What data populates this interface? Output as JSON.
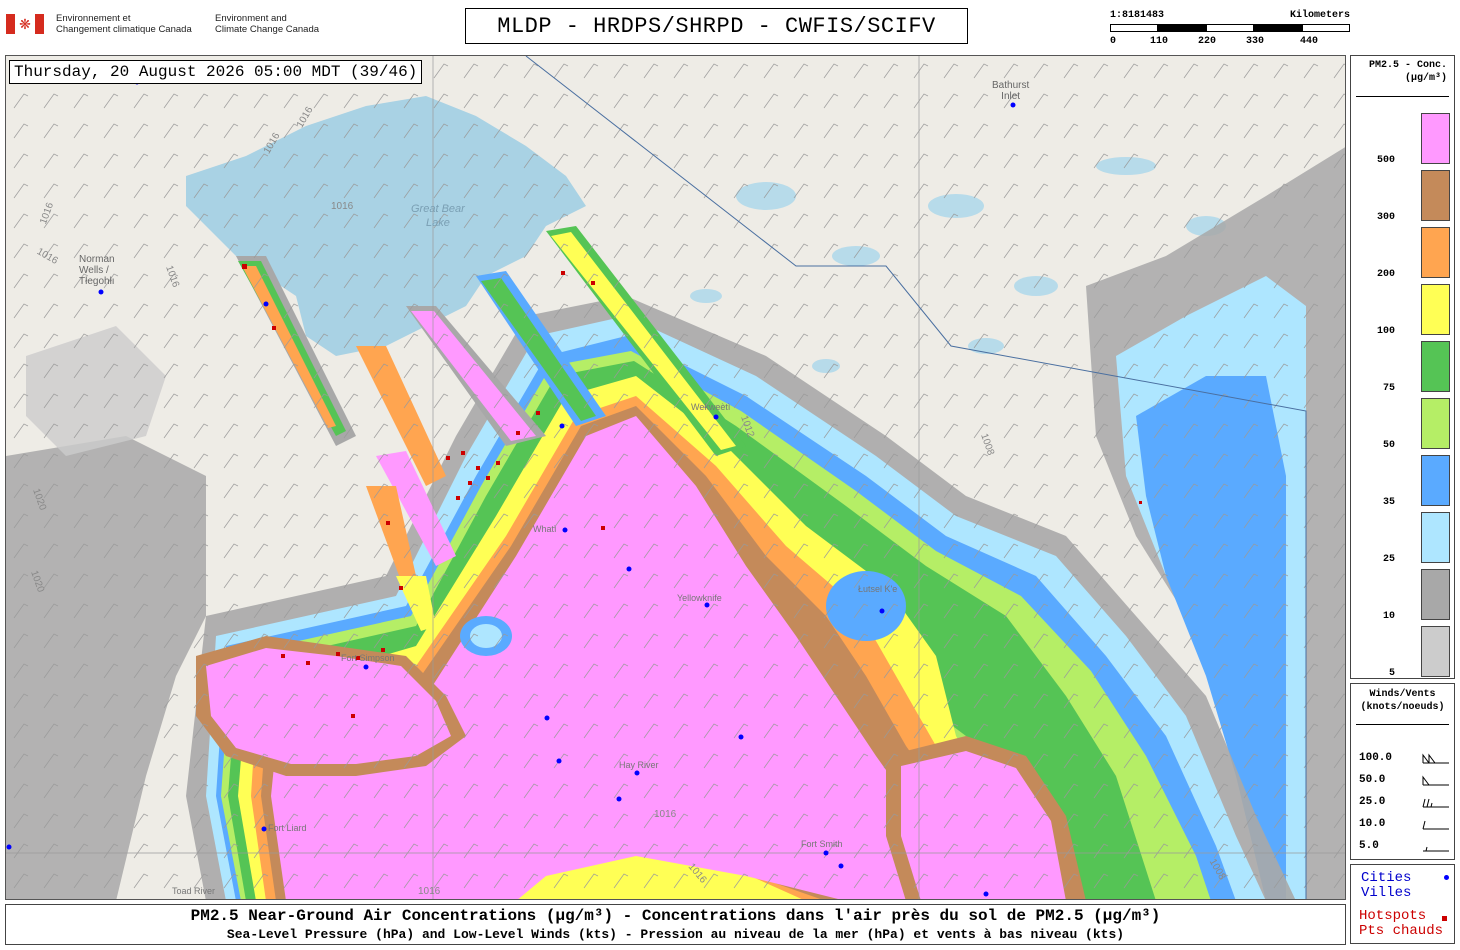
{
  "header": {
    "gov_fr": "Environnement et\nChangement climatique Canada",
    "gov_en": "Environment and\nClimate Change Canada",
    "title": "MLDP - HRDPS/SHRPD - CWFIS/SCIFV"
  },
  "scalebar": {
    "ratio": "1:8181483",
    "unit": "Kilometers",
    "ticks": [
      "0",
      "110",
      "220",
      "330",
      "440"
    ]
  },
  "map": {
    "timestamp": "Thursday, 20 August 2026 05:00 MDT (39/46)",
    "places": [
      {
        "name": "Bathurst\nInlet"
      },
      {
        "name": "Great Bear\nLake"
      },
      {
        "name": "Norman\nWells /\nTłegohłı"
      },
      {
        "name": "Wekweètì"
      },
      {
        "name": "Whatì"
      },
      {
        "name": "Yellowknife"
      },
      {
        "name": "Łutsel K'e"
      },
      {
        "name": "Fort Simpson"
      },
      {
        "name": "Hay River"
      },
      {
        "name": "Fort Smith"
      },
      {
        "name": "Fort Liard"
      },
      {
        "name": "Toad River"
      }
    ],
    "isobars": [
      "1016",
      "1016",
      "1016",
      "1016",
      "1016",
      "1016",
      "1020",
      "1020",
      "1012",
      "1008",
      "1016",
      "1016",
      "1008",
      "1016"
    ]
  },
  "legend": {
    "conc_title": "PM2.5 - Conc.\n(µg/m³)",
    "bins": [
      {
        "label": "500",
        "color": "#ff99ff"
      },
      {
        "label": "300",
        "color": "#c48a5a"
      },
      {
        "label": "200",
        "color": "#ffa550"
      },
      {
        "label": "100",
        "color": "#ffff55"
      },
      {
        "label": "75",
        "color": "#55c455"
      },
      {
        "label": "50",
        "color": "#b5ee66"
      },
      {
        "label": "35",
        "color": "#5aaaff"
      },
      {
        "label": "25",
        "color": "#aee6ff"
      },
      {
        "label": "10",
        "color": "#a8a8a8"
      },
      {
        "label": "5",
        "color": "#cccccc"
      }
    ],
    "wind_title": "Winds/Vents\n(knots/noeuds)",
    "winds": [
      "100.0",
      "50.0",
      "25.0",
      "10.0",
      "5.0"
    ],
    "cities": "Cities\nVilles",
    "hotspots": "Hotspots\nPts chauds"
  },
  "footer": {
    "line1": "PM2.5 Near-Ground Air Concentrations (µg/m³) - Concentrations dans l'air près du sol de PM2.5 (µg/m³)",
    "line2": "Sea-Level Pressure (hPa) and Low-Level Winds (kts) - Pression au niveau de la mer (hPa) et vents à bas niveau (kts)"
  }
}
